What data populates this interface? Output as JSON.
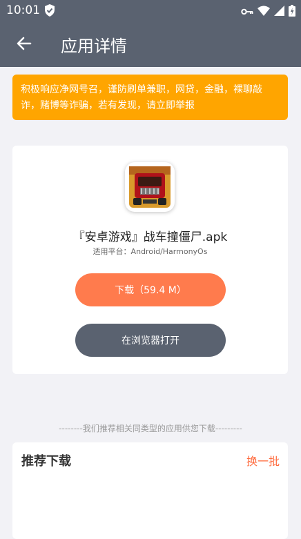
{
  "status_bar": {
    "time": "10:01"
  },
  "app_bar": {
    "title": "应用详情"
  },
  "notice": {
    "text": "积极响应净网号召，谨防刷单兼职，网贷，金融，裸聊敲诈，赌博等诈骗，若有发现，请立即举报"
  },
  "app_info": {
    "filename": "『安卓游戏』战车撞僵尸.apk",
    "platform": "适用平台：Android/HarmonyOs"
  },
  "buttons": {
    "download": "下载（59.4 M）",
    "open_browser": "在浏览器打开"
  },
  "recommend": {
    "hint": "--------我们推荐相关同类型的应用供您下载---------",
    "title": "推荐下载",
    "refresh": "换一批"
  },
  "colors": {
    "header": "#5a6270",
    "notice": "#ffa500",
    "download_button": "#ff7b4d",
    "refresh_link": "#ff6a3d"
  },
  "icons": [
    "shield-check-icon",
    "vpn-key-icon",
    "wifi-icon",
    "signal-icon",
    "battery-icon",
    "back-arrow-icon",
    "app-icon"
  ]
}
